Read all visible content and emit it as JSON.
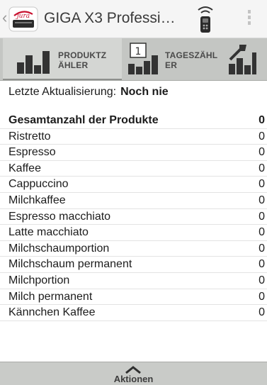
{
  "header": {
    "back_glyph": "‹",
    "title": "GIGA X3 Professi…",
    "logo_icon": "jura-connect-logo",
    "remote_icon": "remote-control-icon",
    "overflow_icon": "overflow-menu-icon"
  },
  "tabs": [
    {
      "label_line1": "PRODUKTZ",
      "label_line2": "ÄHLER",
      "icon": "bar-chart-icon",
      "selected": true
    },
    {
      "label_line1": "TAGESZÄHL",
      "label_line2": "ER",
      "icon": "daily-counter-icon",
      "selected": false
    },
    {
      "label_line1": "",
      "label_line2": "",
      "icon": "maintenance-wrench-icon",
      "selected": false
    }
  ],
  "last_update": {
    "label": "Letzte Aktualisierung:",
    "value": "Noch nie"
  },
  "products": [
    {
      "name": "Gesamtanzahl der Produkte",
      "count": "0",
      "total": true
    },
    {
      "name": "Ristretto",
      "count": "0"
    },
    {
      "name": "Espresso",
      "count": "0"
    },
    {
      "name": "Kaffee",
      "count": "0"
    },
    {
      "name": "Cappuccino",
      "count": "0"
    },
    {
      "name": "Milchkaffee",
      "count": "0"
    },
    {
      "name": "Espresso macchiato",
      "count": "0"
    },
    {
      "name": "Latte macchiato",
      "count": "0"
    },
    {
      "name": "Milchschaumportion",
      "count": "0"
    },
    {
      "name": "Milchschaum permanent",
      "count": "0"
    },
    {
      "name": "Milchportion",
      "count": "0"
    },
    {
      "name": "Milch permanent",
      "count": "0"
    },
    {
      "name": "Kännchen Kaffee",
      "count": "0"
    }
  ],
  "bottom_bar": {
    "label": "Aktionen",
    "icon": "chevron-up-icon"
  },
  "colors": {
    "brand_red": "#c8102e",
    "tab_strip": "#c4c6c3",
    "text": "#1c1c1c"
  }
}
